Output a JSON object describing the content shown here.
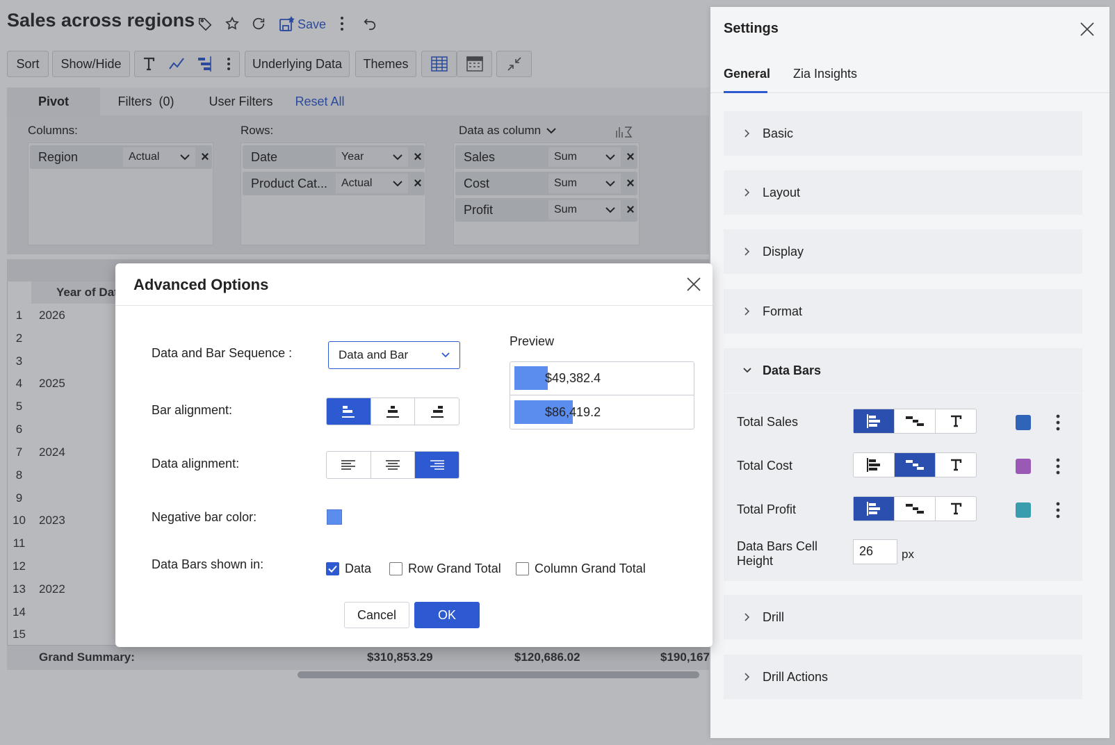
{
  "report": {
    "title": "Sales across regions",
    "save_label": "Save"
  },
  "toolbar": {
    "sort": "Sort",
    "show_hide": "Show/Hide",
    "underlying_data": "Underlying Data",
    "themes": "Themes"
  },
  "tabs": {
    "pivot": "Pivot",
    "filters": "Filters  (0)",
    "user_filters": "User Filters",
    "reset_all": "Reset All"
  },
  "pivot_config": {
    "columns_label": "Columns:",
    "rows_label": "Rows:",
    "data_label": "Data as column",
    "columns": [
      {
        "name": "Region",
        "func": "Actual"
      }
    ],
    "rows": [
      {
        "name": "Date",
        "func": "Year"
      },
      {
        "name": "Product Cat...",
        "func": "Actual"
      }
    ],
    "data": [
      {
        "name": "Sales",
        "func": "Sum"
      },
      {
        "name": "Cost",
        "func": "Sum"
      },
      {
        "name": "Profit",
        "func": "Sum"
      }
    ]
  },
  "grid": {
    "header": "Year of Dat",
    "row_numbers": [
      "1",
      "2",
      "3",
      "4",
      "5",
      "6",
      "7",
      "8",
      "9",
      "10",
      "11",
      "12",
      "13",
      "14",
      "15"
    ],
    "years": [
      "2026",
      "2025",
      "2024",
      "2023",
      "2022"
    ],
    "grand_summary_label": "Grand Summary:",
    "grand_summary_values": [
      "$310,853.29",
      "$120,686.02",
      "$190,167"
    ]
  },
  "settings": {
    "title": "Settings",
    "tabs": [
      "General",
      "Zia Insights"
    ],
    "sections": [
      "Basic",
      "Layout",
      "Display",
      "Format",
      "Data Bars",
      "Drill",
      "Drill Actions"
    ],
    "data_bars": {
      "rows": [
        {
          "label": "Total Sales",
          "color": "#2f64b9"
        },
        {
          "label": "Total Cost",
          "color": "#9b59b6"
        },
        {
          "label": "Total Profit",
          "color": "#3a9dae"
        }
      ],
      "cell_height_label_1": "Data Bars Cell",
      "cell_height_label_2": "Height",
      "cell_height_value": "26",
      "cell_height_unit": "px"
    }
  },
  "modal": {
    "title": "Advanced Options",
    "sequence_label": "Data and Bar Sequence :",
    "sequence_value": "Data and Bar",
    "bar_alignment_label": "Bar alignment:",
    "data_alignment_label": "Data alignment:",
    "negative_color_label": "Negative bar color:",
    "negative_color": "#5b8def",
    "shown_in_label": "Data Bars shown in:",
    "shown_in": [
      {
        "label": "Data",
        "checked": true
      },
      {
        "label": "Row Grand Total",
        "checked": false
      },
      {
        "label": "Column Grand Total",
        "checked": false
      }
    ],
    "preview_label": "Preview",
    "preview_values": [
      {
        "text": "$49,382.4",
        "fraction": 0.57
      },
      {
        "text": "$86,419.2",
        "fraction": 1.0
      }
    ],
    "cancel": "Cancel",
    "ok": "OK"
  }
}
